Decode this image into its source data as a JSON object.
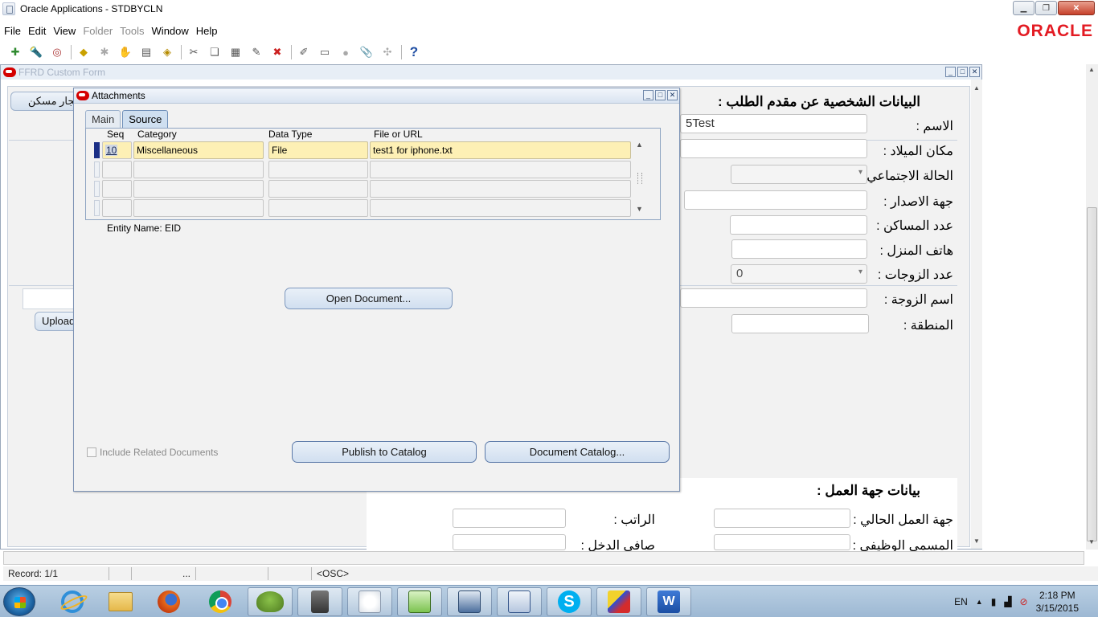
{
  "window": {
    "title": "Oracle Applications - STDBYCLN",
    "brand": "ORACLE",
    "brand_color": "#e31b23"
  },
  "menu": {
    "items": [
      {
        "label": "File",
        "enabled": true
      },
      {
        "label": "Edit",
        "enabled": true
      },
      {
        "label": "View",
        "enabled": true
      },
      {
        "label": "Folder",
        "enabled": false
      },
      {
        "label": "Tools",
        "enabled": false
      },
      {
        "label": "Window",
        "enabled": true
      },
      {
        "label": "Help",
        "enabled": true
      }
    ]
  },
  "toolbar": {
    "icons": [
      "new-record-icon",
      "find-icon",
      "navigator-icon",
      "save-icon",
      "next-step-icon",
      "switch-responsibility-icon",
      "print-icon",
      "close-form-icon",
      "cut-icon",
      "copy-icon",
      "paste-icon",
      "clear-record-icon",
      "delete-record-icon",
      "edit-field-icon",
      "zoom-icon",
      "translations-icon",
      "attachments-icon",
      "folder-tools-icon",
      "help-icon"
    ]
  },
  "ffrd": {
    "title": "FFRD Custom Form",
    "left_button": "إيجار مسكن",
    "upload_button": "Upload",
    "personal_heading": "البيانات الشخصية عن مقدم الطلب :",
    "fields": {
      "name_label": "الاسم :",
      "name_value": "5Test",
      "birthplace_label": "مكان الميلاد :",
      "marital_label": "الحالة الاجتماعي",
      "issuer_label": "جهة الاصدار :",
      "residents_label": "عدد المساكن :",
      "home_phone_label": "هاتف المنزل :",
      "wives_label": "عدد الزوجات :",
      "wives_value": "0",
      "wife_name_label": "اسم الزوجة :",
      "region_label": "المنطقة :"
    },
    "employer_heading": "بيانات جهة العمل :",
    "employer_fields": {
      "current_employer_label": "جهة العمل الحالي :",
      "salary_label": "الراتب :",
      "job_title_label": "المسمى الوظيفي :",
      "net_income_label": "صافي الدخل :"
    }
  },
  "attachments": {
    "title": "Attachments",
    "tabs": [
      {
        "label": "Main",
        "active": false
      },
      {
        "label": "Source",
        "active": true
      }
    ],
    "columns": {
      "seq": "Seq",
      "category": "Category",
      "data_type": "Data Type",
      "file_or_url": "File or URL"
    },
    "rows": [
      {
        "seq": "10",
        "category": "Miscellaneous",
        "data_type": "File",
        "file": "test1 for iphone.txt"
      },
      {
        "seq": "",
        "category": "",
        "data_type": "",
        "file": ""
      },
      {
        "seq": "",
        "category": "",
        "data_type": "",
        "file": ""
      },
      {
        "seq": "",
        "category": "",
        "data_type": "",
        "file": ""
      }
    ],
    "entity_label": "Entity Name:",
    "entity_value": "EID",
    "open_document": "Open Document...",
    "include_related": "Include Related Documents",
    "publish_to_catalog": "Publish to Catalog",
    "document_catalog": "Document Catalog..."
  },
  "status_bar": {
    "record": "Record: 1/1",
    "ellipsis": "...",
    "osc": "<OSC>"
  },
  "taskbar": {
    "apps": [
      "internet-explorer-icon",
      "file-explorer-icon",
      "firefox-icon",
      "chrome-icon",
      "frog-app-icon",
      "network-app-icon",
      "java-icon",
      "chart-app-icon",
      "remote-desktop-icon",
      "spreadsheet-app-icon",
      "skype-icon",
      "paint-app-icon",
      "word-icon"
    ],
    "language": "EN",
    "time": "2:18 PM",
    "date": "3/15/2015"
  }
}
